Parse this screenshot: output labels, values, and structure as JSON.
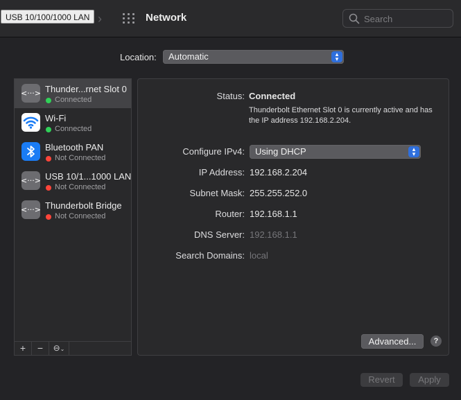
{
  "titlebar": {
    "tooltip": "USB 10/100/1000 LAN",
    "forward_glyph": "›",
    "title": "Network",
    "search_placeholder": "Search"
  },
  "location": {
    "label": "Location:",
    "value": "Automatic"
  },
  "services": [
    {
      "name": "Thunder...rnet Slot 0",
      "status": "Connected",
      "status_color": "#30d158",
      "icon": "ethernet-icon",
      "selected": true
    },
    {
      "name": "Wi-Fi",
      "status": "Connected",
      "status_color": "#30d158",
      "icon": "wifi-icon",
      "selected": false
    },
    {
      "name": "Bluetooth PAN",
      "status": "Not Connected",
      "status_color": "#ff453a",
      "icon": "bluetooth-icon",
      "selected": false
    },
    {
      "name": "USB 10/1...1000 LAN",
      "status": "Not Connected",
      "status_color": "#ff453a",
      "icon": "ethernet-icon",
      "selected": false
    },
    {
      "name": "Thunderbolt Bridge",
      "status": "Not Connected",
      "status_color": "#ff453a",
      "icon": "ethernet-icon",
      "selected": false
    }
  ],
  "list_toolbar": {
    "add": "+",
    "remove": "−",
    "action": "⊖"
  },
  "detail": {
    "status_label": "Status:",
    "status_value": "Connected",
    "status_description": "Thunderbolt Ethernet Slot 0 is currently active and has the IP address 192.168.2.204.",
    "configure_label": "Configure IPv4:",
    "configure_value": "Using DHCP",
    "ip_label": "IP Address:",
    "ip_value": "192.168.2.204",
    "subnet_label": "Subnet Mask:",
    "subnet_value": "255.255.252.0",
    "router_label": "Router:",
    "router_value": "192.168.1.1",
    "dns_label": "DNS Server:",
    "dns_value": "192.168.1.1",
    "domains_label": "Search Domains:",
    "domains_value": "local",
    "advanced": "Advanced...",
    "help": "?"
  },
  "footer": {
    "revert": "Revert",
    "apply": "Apply"
  },
  "colors": {
    "accent": "#2f6fdc",
    "connected": "#30d158",
    "not_connected": "#ff453a"
  }
}
